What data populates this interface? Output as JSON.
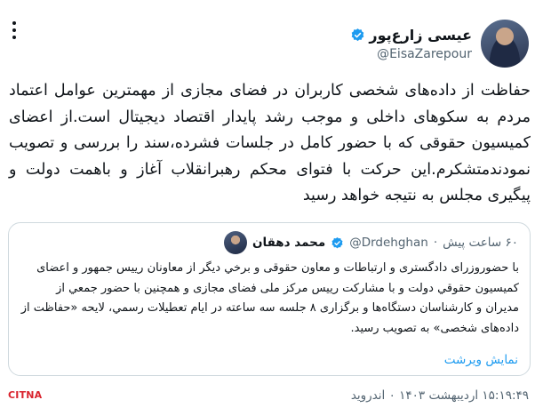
{
  "tweet": {
    "author": {
      "name": "عیسی زارع‌پور",
      "handle": "@EisaZarepour"
    },
    "text": "حفاظت از داده‌های شخصی کاربران در فضای مجازی از مهمترین عوامل اعتماد مردم به سکوهای داخلی و موجب رشد پایدار اقتصاد دیجیتال است.از اعضای کمیسیون حقوقی که با حضور کامل در جلسات فشرده،سند را بررسی و تصویب نمودندمتشکرم.این حرکت با فتوای محکم رهبرانقلاب آغاز و باهمت دولت و پیگیری مجلس به نتیجه خواهد رسید",
    "timestamp": "۱۵:۱۹:۴۹ اردیبهشت ۱۴۰۳ ۰ اندروید",
    "quote": {
      "name": "محمد دهقان",
      "handle": "@Drdehghan",
      "separator": "·",
      "time": "۶۰ ساعت پیش",
      "text": "با حضوروزرای دادگستری و ارتباطات و معاون حقوقی و برخي ديگر از معاونان رییس جمهور و اعضای کمیسیون حقوقي دولت و با مشارکت رییس مرکز ملی فضای مجازی و همچنین با حضور جمعي از مديران و كارشناسان دستگاه‌ها و برگزاری ٨ جلسه سه ساعته در ایام تعطیلات رسمي، لايحه «حفاظت از داده‌های شخصی» به تصویب رسید.",
      "show_more": "نمایش ویرشت"
    }
  },
  "watermark": "CITNA",
  "colors": {
    "accent": "#1d9bf0",
    "secondary_text": "#536471",
    "border": "#cfd9de",
    "watermark": "#d9232d"
  },
  "icons": {
    "more": "more-vertical-icon",
    "verified": "verified-badge-icon"
  }
}
